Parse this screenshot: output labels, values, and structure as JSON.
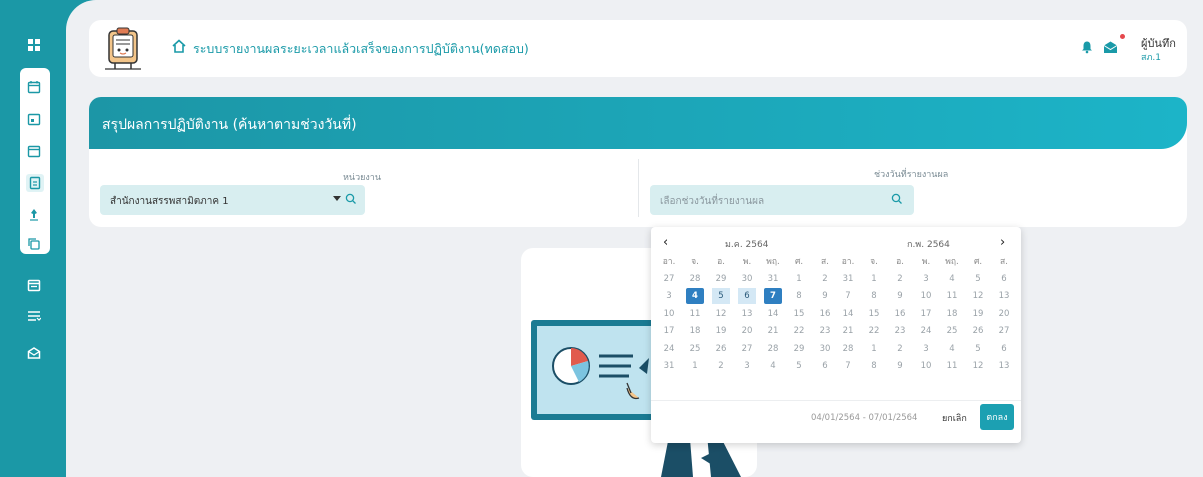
{
  "header": {
    "app_title": "ระบบรายงานผลระยะเวลาแล้วเสร็จของการปฏิบัติงาน(ทดสอบ)",
    "user_name": "ผู้บันทึก",
    "user_unit": "สภ.1"
  },
  "sidebar": {
    "items": [
      "dashboard-icon",
      "calendar-icon",
      "calendar-icon",
      "calendar-icon",
      "document-icon",
      "pin-icon",
      "copy-icon",
      "calendar-icon",
      "list-icon",
      "mail-icon"
    ]
  },
  "page": {
    "title": "สรุปผลการปฏิบัติงาน (ค้นหาตามช่วงวันที่)"
  },
  "filters": {
    "unit_label": "หน่วยงาน",
    "unit_value": "สำนักงานสรรพสามิตภาค 1",
    "date_label": "ช่วงวันที่รายงานผล",
    "date_placeholder": "เลือกช่วงวันที่รายงานผล"
  },
  "calendar": {
    "left_month": "ม.ค. 2564",
    "right_month": "ก.พ. 2564",
    "weekdays": [
      "อา.",
      "จ.",
      "อ.",
      "พ.",
      "พฤ.",
      "ศ.",
      "ส."
    ],
    "left_days": [
      [
        "27",
        "28",
        "29",
        "30",
        "31",
        "1",
        "2"
      ],
      [
        "3",
        "4",
        "5",
        "6",
        "7",
        "8",
        "9"
      ],
      [
        "10",
        "11",
        "12",
        "13",
        "14",
        "15",
        "16"
      ],
      [
        "17",
        "18",
        "19",
        "20",
        "21",
        "22",
        "23"
      ],
      [
        "24",
        "25",
        "26",
        "27",
        "28",
        "29",
        "30"
      ],
      [
        "31",
        "1",
        "2",
        "3",
        "4",
        "5",
        "6"
      ]
    ],
    "right_days": [
      [
        "31",
        "1",
        "2",
        "3",
        "4",
        "5",
        "6"
      ],
      [
        "7",
        "8",
        "9",
        "10",
        "11",
        "12",
        "13"
      ],
      [
        "14",
        "15",
        "16",
        "17",
        "18",
        "19",
        "20"
      ],
      [
        "21",
        "22",
        "23",
        "24",
        "25",
        "26",
        "27"
      ],
      [
        "28",
        "1",
        "2",
        "3",
        "4",
        "5",
        "6"
      ],
      [
        "7",
        "8",
        "9",
        "10",
        "11",
        "12",
        "13"
      ]
    ],
    "selected_start": "4",
    "selected_end": "7",
    "range_text": "04/01/2564 - 07/01/2564",
    "cancel_label": "ยกเลิก",
    "ok_label": "ตกลง"
  },
  "colors": {
    "primary": "#1b98a6",
    "selected": "#2f7fc1",
    "range": "#d4e8f5"
  }
}
